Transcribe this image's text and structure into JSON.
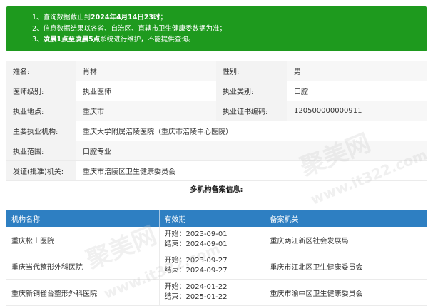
{
  "notice": {
    "line1_prefix": "1、查询数据截止到",
    "line1_bold": "2024年4月14日23时",
    "line1_suffix": "；",
    "line2": "2、信息数据结果以各省、自治区、直辖市卫生健康委数据为准；",
    "line3_prefix": "3、",
    "line3_bold": "凌晨1点至凌晨5点",
    "line3_suffix": "系统进行维护，不能提供查询。"
  },
  "info": {
    "name_label": "姓名:",
    "name_value": "肖林",
    "gender_label": "性别:",
    "gender_value": "男",
    "level_label": "医师级别:",
    "level_value": "执业医师",
    "category_label": "执业类别:",
    "category_value": "口腔",
    "location_label": "执业地点:",
    "location_value": "重庆市",
    "cert_label": "执业证书编码:",
    "cert_value": "120500000000911",
    "institution_label": "主要执业机构:",
    "institution_value": "重庆大学附属涪陵医院（重庆市涪陵中心医院）",
    "scope_label": "执业范围:",
    "scope_value": "口腔专业",
    "issuer_label": "发证(批准)机关:",
    "issuer_value": "重庆市涪陵区卫生健康委员会"
  },
  "section_title": "多机构备案信息:",
  "institutions": {
    "headers": [
      "机构名称",
      "有效期",
      "备案机关"
    ],
    "start_label": "开始：",
    "end_label": "结束：",
    "rows": [
      {
        "name": "重庆松山医院",
        "start": "2023-09-01",
        "end": "2024-09-01",
        "authority": "重庆两江新区社会发展局"
      },
      {
        "name": "重庆当代整形外科医院",
        "start": "2023-09-27",
        "end": "2024-09-27",
        "authority": "重庆市江北区卫生健康委员会"
      },
      {
        "name": "重庆新铜雀台整形外科医院",
        "start": "2024-01-22",
        "end": "2025-01-22",
        "authority": "重庆市渝中区卫生健康委员会"
      }
    ]
  },
  "watermark": {
    "brand": "聚美网",
    "url": "www.it322.com"
  }
}
